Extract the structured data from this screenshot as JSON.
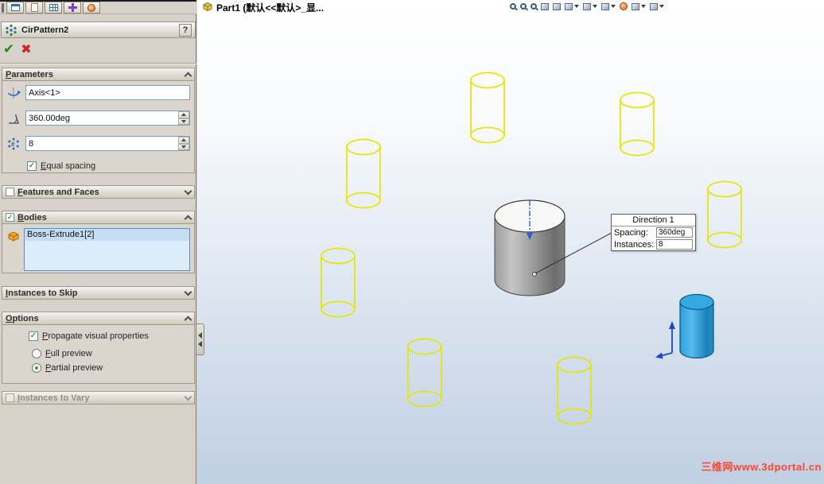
{
  "app_toolbar": {
    "icons": [
      {
        "name": "window",
        "glyph": "window"
      },
      {
        "name": "annotation",
        "glyph": "doc"
      },
      {
        "name": "design-table",
        "glyph": "table"
      },
      {
        "name": "move",
        "glyph": "move"
      },
      {
        "name": "appearance",
        "glyph": "ball"
      }
    ]
  },
  "property_manager": {
    "title": "CirPattern2",
    "help_label": "?",
    "parameters": {
      "title": "Parameters",
      "axis_value": "Axis<1>",
      "angle_value": "360.00deg",
      "count_value": "8",
      "equal_spacing_label": "Equal spacing"
    },
    "features_and_faces": {
      "title": "Features and Faces"
    },
    "bodies": {
      "title": "Bodies",
      "items": [
        "Boss-Extrude1[2]"
      ]
    },
    "instances_to_skip": {
      "title": "Instances to Skip"
    },
    "options": {
      "title": "Options",
      "propagate_label": "Propagate visual properties",
      "full_preview_label": "Full preview",
      "partial_preview_label": "Partial preview"
    },
    "instances_to_vary": {
      "title": "Instances to Vary"
    }
  },
  "viewport": {
    "title": "Part1 (默认<<默认>_显...",
    "toolbar_icons": [
      {
        "name": "zoom-fit",
        "glyph": "lens",
        "dropdown": false
      },
      {
        "name": "zoom-area",
        "glyph": "lens",
        "dropdown": false
      },
      {
        "name": "zoom-in-out",
        "glyph": "lens",
        "dropdown": false
      },
      {
        "name": "previous-view",
        "glyph": "cube",
        "dropdown": false
      },
      {
        "name": "section-view",
        "glyph": "cube",
        "dropdown": false
      },
      {
        "name": "view-orientation",
        "glyph": "cube",
        "dropdown": true
      },
      {
        "name": "display-style",
        "glyph": "cube",
        "dropdown": true
      },
      {
        "name": "hide-show-items",
        "glyph": "cube",
        "dropdown": true
      },
      {
        "name": "edit-appearance",
        "glyph": "ball",
        "dropdown": false
      },
      {
        "name": "apply-scene",
        "glyph": "cube",
        "dropdown": true
      },
      {
        "name": "view-settings",
        "glyph": "cube",
        "dropdown": true
      }
    ],
    "callout": {
      "title": "Direction 1",
      "spacing_label": "Spacing:",
      "spacing_value": "360deg",
      "instances_label": "Instances:",
      "instances_value": "8"
    },
    "watermark": "三维网www.3dportal.cn"
  },
  "icons": {
    "pm_title": "circular-pattern-icon",
    "ok": "green-check-icon",
    "cancel": "red-x-icon",
    "axis_row": "pattern-axis-icon",
    "angle_row": "pattern-angle-icon",
    "count_row": "instance-count-icon",
    "bodies_row": "solid-body-icon"
  },
  "colors": {
    "preview_wireframe": "#e6e600",
    "seed_body": "#2ba3dd",
    "selection_fill": "#ddecf9",
    "watermark": "#ff4633"
  }
}
